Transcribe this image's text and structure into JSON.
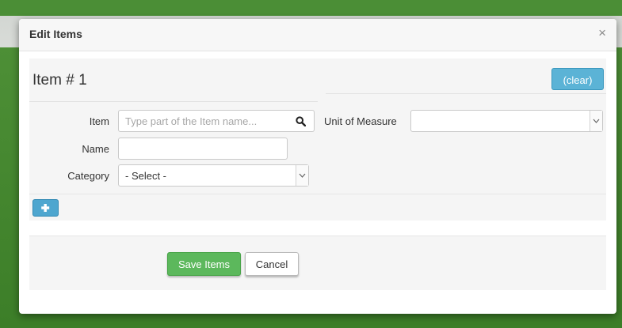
{
  "modal": {
    "title": "Edit Items",
    "close_label": "×"
  },
  "item": {
    "heading": "Item # 1",
    "clear_label": "(clear)",
    "fields": {
      "item_label": "Item",
      "item_placeholder": "Type part of the Item name...",
      "item_value": "",
      "uom_label": "Unit of Measure",
      "uom_selected": "",
      "name_label": "Name",
      "name_value": "",
      "category_label": "Category",
      "category_selected": "- Select -"
    }
  },
  "actions": {
    "save_label": "Save Items",
    "cancel_label": "Cancel"
  },
  "icons": {
    "search": "search-icon",
    "add": "plus-icon",
    "close": "close-icon",
    "chevron": "chevron-down-icon"
  },
  "colors": {
    "primary": "#5bb3d6",
    "success": "#5cb85c",
    "background": "#3f8a2c"
  }
}
